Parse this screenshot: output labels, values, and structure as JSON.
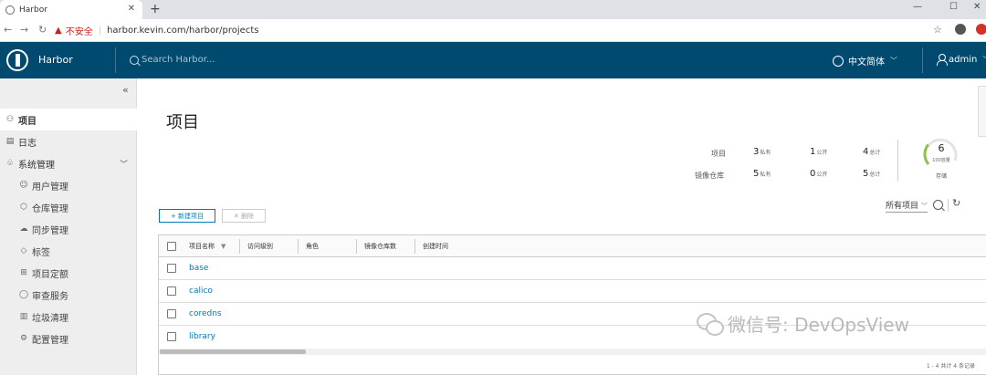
{
  "browser": {
    "tab_title": "Harbor",
    "tab_close": "✕",
    "new_tab": "+",
    "win_min": "—",
    "win_max": "☐",
    "win_close": "✕",
    "insecure_label": "不安全",
    "url": "harbor.kevin.com/harbor/projects"
  },
  "header": {
    "brand": "Harbor",
    "search_placeholder": "Search Harbor...",
    "language": "中文简体",
    "user": "admin"
  },
  "sidebar": {
    "items": [
      {
        "label": "项目",
        "icon": "projects-icon"
      },
      {
        "label": "日志",
        "icon": "logs-icon"
      },
      {
        "label": "系统管理",
        "icon": "admin-icon"
      }
    ],
    "sub_items": [
      {
        "label": "用户管理",
        "icon": "users-icon"
      },
      {
        "label": "仓库管理",
        "icon": "registry-icon"
      },
      {
        "label": "同步管理",
        "icon": "replication-icon"
      },
      {
        "label": "标签",
        "icon": "tag-icon"
      },
      {
        "label": "项目定额",
        "icon": "quota-icon"
      },
      {
        "label": "审查服务",
        "icon": "shield-icon"
      },
      {
        "label": "垃圾清理",
        "icon": "trash-icon"
      },
      {
        "label": "配置管理",
        "icon": "gear-icon"
      }
    ]
  },
  "main": {
    "title": "项目",
    "stats": {
      "projects_label": "项目",
      "repos_label": "镜像仓库",
      "private_label": "私有",
      "public_label": "公开",
      "total_label": "总计",
      "projects": {
        "private": "3",
        "public": "1",
        "total": "4"
      },
      "repos": {
        "private": "5",
        "public": "0",
        "total": "5"
      }
    },
    "storage": {
      "value": "6",
      "sublabel": "100容量",
      "label": "存储",
      "used_fraction": 0.06
    },
    "new_button": "+ 新建项目",
    "delete_button": "✕ 删除",
    "filter": "所有项目",
    "columns": [
      "项目名称",
      "访问级别",
      "角色",
      "镜像仓库数",
      "创建时间"
    ],
    "rows": [
      "base",
      "calico",
      "coredns",
      "library"
    ],
    "pagination": "1 - 4 共计 4 条记录"
  },
  "watermark": "微信号: DevOpsView",
  "colors": {
    "header_bg": "#004a70",
    "link": "#0079b8",
    "gauge": "#8cc152"
  }
}
